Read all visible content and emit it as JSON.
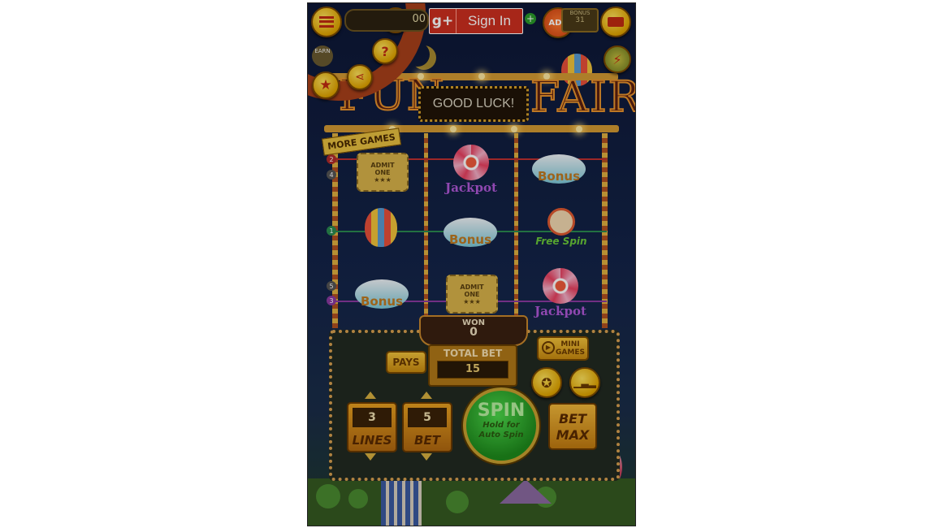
{
  "header": {
    "sign_in_label": "Sign In",
    "google_plus_glyph": "g+",
    "coin_value_visible": "00",
    "bonus_label": "BONUS",
    "bonus_timer": "31",
    "no_ads_label": "ADS"
  },
  "side_menu": {
    "earn_label": "EARN",
    "more_games_label": "MORE GAMES",
    "icons": [
      "menu-icon",
      "gear-icon",
      "help-icon",
      "star-icon",
      "share-icon"
    ]
  },
  "marquee": {
    "left_title": "FUN",
    "right_title": "FAIR",
    "message": "GOOD LUCK!"
  },
  "reels": {
    "columns": [
      [
        {
          "type": "ticket",
          "lines": [
            "ADMIT",
            "ONE",
            "★★★"
          ]
        },
        {
          "type": "balloon",
          "label": ""
        },
        {
          "type": "bonus",
          "label": "Bonus"
        }
      ],
      [
        {
          "type": "wheel",
          "label": "Jackpot"
        },
        {
          "type": "bonus",
          "label": "Bonus"
        },
        {
          "type": "ticket",
          "lines": [
            "ADMIT",
            "ONE",
            "★★★"
          ]
        }
      ],
      [
        {
          "type": "bonus",
          "label": "Bonus"
        },
        {
          "type": "clown",
          "label": "Free Spin"
        },
        {
          "type": "wheel",
          "label": "Jackpot"
        }
      ]
    ],
    "line_markers": [
      "2",
      "4",
      "1",
      "5",
      "3"
    ]
  },
  "controls": {
    "won_label": "WON",
    "won_value": "0",
    "pays_label": "PAYS",
    "total_bet_label": "TOTAL BET",
    "total_bet_value": "15",
    "mini_games_label_1": "MINI",
    "mini_games_label_2": "GAMES",
    "lines_value": "3",
    "lines_label": "LINES",
    "bet_value": "5",
    "bet_label": "BET",
    "spin_label": "SPIN",
    "spin_hint_1": "Hold for",
    "spin_hint_2": "Auto Spin",
    "bet_max_label_1": "BET",
    "bet_max_label_2": "MAX"
  },
  "colors": {
    "sign_in_red": "#cc2f1f",
    "gold": "#e0a400",
    "spin_green": "#1e8a1c"
  }
}
